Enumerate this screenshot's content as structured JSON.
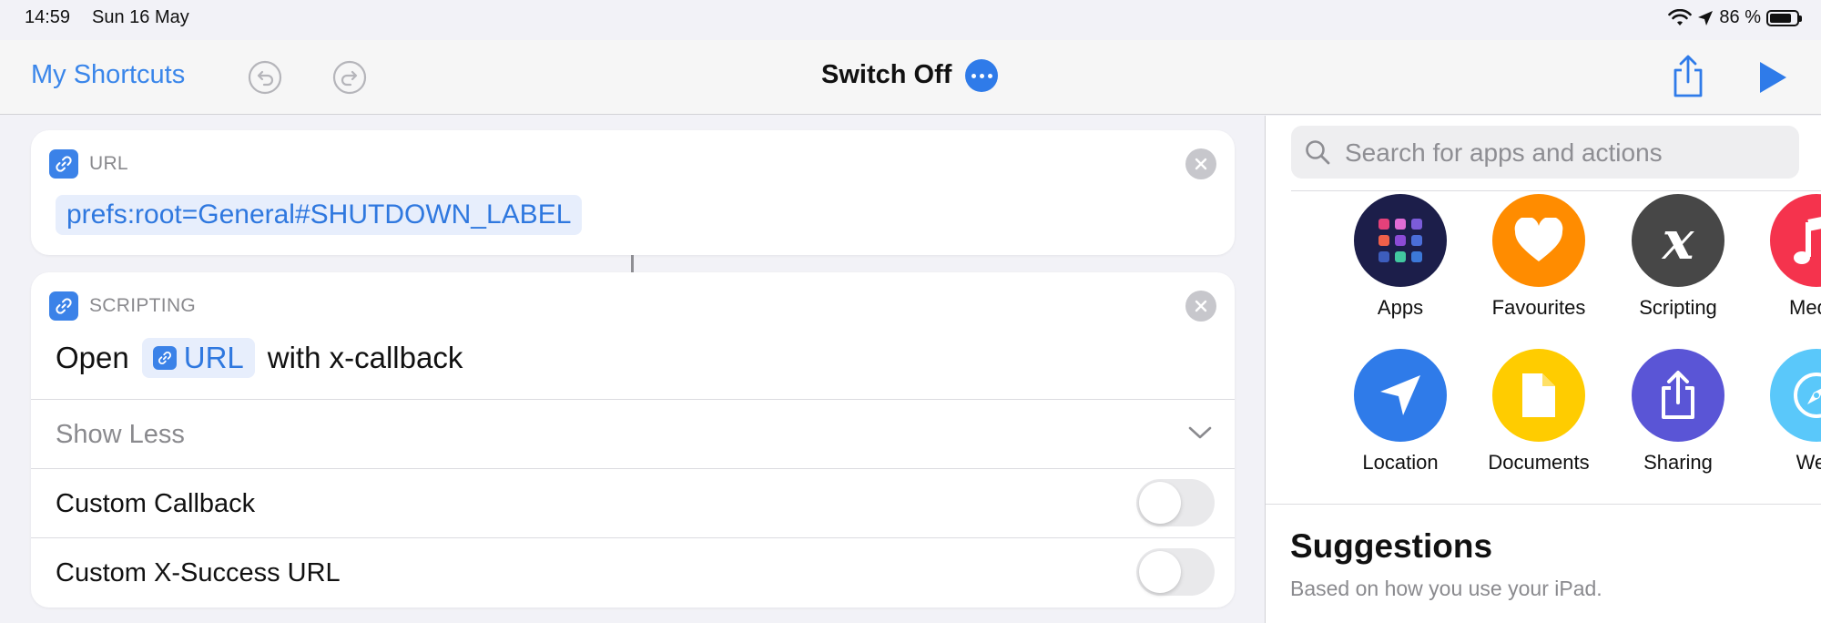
{
  "status_bar": {
    "time": "14:59",
    "date": "Sun 16 May",
    "battery": "86 %"
  },
  "nav": {
    "back_label": "My Shortcuts",
    "title": "Switch Off"
  },
  "actions": {
    "url_card": {
      "header": "URL",
      "value": "prefs:root=General#SHUTDOWN_LABEL"
    },
    "scripting_card": {
      "header": "SCRIPTING",
      "open_word": "Open",
      "variable": "URL",
      "suffix": "with x-callback",
      "show_less": "Show Less",
      "options": [
        {
          "label": "Custom Callback",
          "enabled": false
        },
        {
          "label": "Custom X-Success URL",
          "enabled": false
        }
      ]
    }
  },
  "panel": {
    "search_placeholder": "Search for apps and actions",
    "categories": [
      {
        "label": "Apps",
        "color": "#1c1e4a",
        "icon": "apps-grid-icon"
      },
      {
        "label": "Favourites",
        "color": "#ff8c00",
        "icon": "heart-icon"
      },
      {
        "label": "Scripting",
        "color": "#474747",
        "icon": "scripting-x-icon"
      },
      {
        "label": "Media",
        "color": "#f5334d",
        "icon": "music-note-icon"
      },
      {
        "label": "Location",
        "color": "#2f7be9",
        "icon": "location-arrow-icon"
      },
      {
        "label": "Documents",
        "color": "#ffcc00",
        "icon": "document-icon"
      },
      {
        "label": "Sharing",
        "color": "#5a55d6",
        "icon": "share-icon"
      },
      {
        "label": "Web",
        "color": "#5ac8fa",
        "icon": "compass-icon"
      }
    ],
    "suggestions_title": "Suggestions",
    "suggestions_subtitle": "Based on how you use your iPad."
  },
  "colors": {
    "accent": "#3a86ea",
    "token_bg": "#e7eefc"
  }
}
